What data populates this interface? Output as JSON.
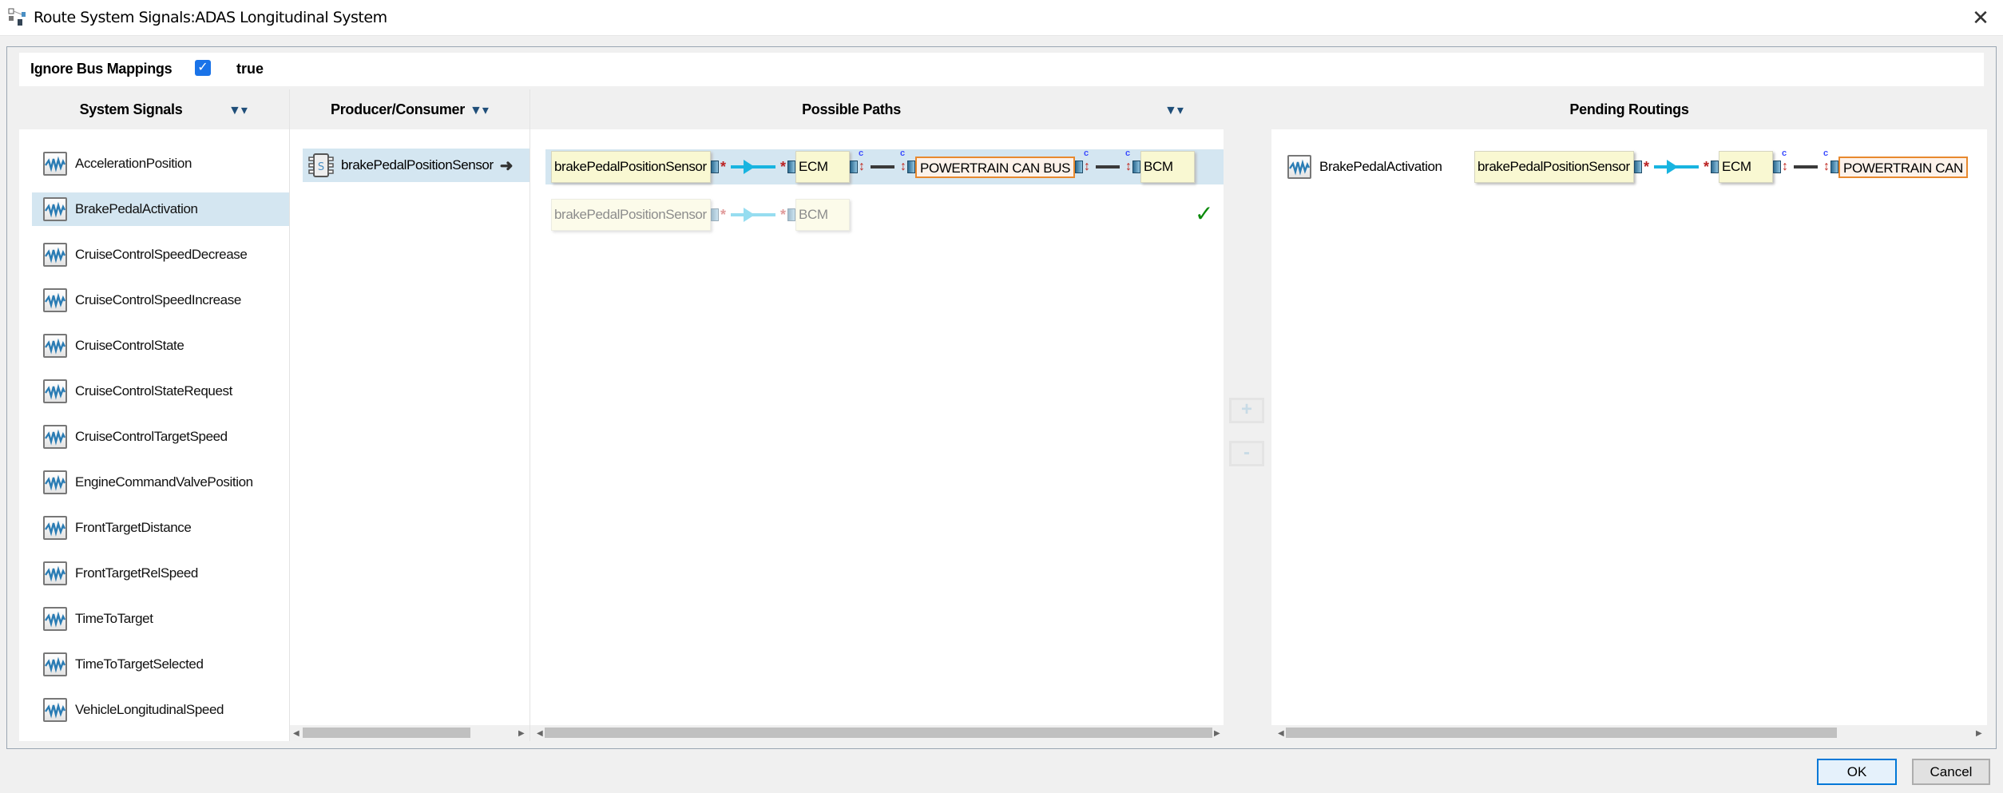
{
  "window": {
    "title": "Route System Signals:ADAS Longitudinal System",
    "close_icon": "✕"
  },
  "ignore_bus_mappings": {
    "label": "Ignore Bus Mappings",
    "checked": true,
    "value": "true"
  },
  "columns": {
    "system_signals": "System Signals",
    "producer_consumer": "Producer/Consumer",
    "possible_paths": "Possible Paths",
    "pending_routings": "Pending Routings"
  },
  "system_signals": {
    "selected": "BrakePedalActivation",
    "items": [
      "AccelerationPosition",
      "BrakePedalActivation",
      "CruiseControlSpeedDecrease",
      "CruiseControlSpeedIncrease",
      "CruiseControlState",
      "CruiseControlStateRequest",
      "CruiseControlTargetSpeed",
      "EngineCommandValvePosition",
      "FrontTargetDistance",
      "FrontTargetRelSpeed",
      "TimeToTarget",
      "TimeToTargetSelected",
      "VehicleLongitudinalSpeed"
    ]
  },
  "producer_consumer": {
    "items": [
      "brakePedalPositionSensor"
    ]
  },
  "possible_paths": [
    {
      "selected": true,
      "valid": false,
      "nodes": [
        "brakePedalPositionSensor",
        "ECM",
        "POWERTRAIN CAN BUS",
        "BCM"
      ],
      "links": [
        "signal",
        "bus",
        "bus"
      ],
      "bus_nodes": [
        2
      ]
    },
    {
      "selected": false,
      "valid": true,
      "faded": true,
      "nodes": [
        "brakePedalPositionSensor",
        "BCM"
      ],
      "links": [
        "signal"
      ],
      "bus_nodes": []
    }
  ],
  "valid_mark": "✓",
  "route_buttons": {
    "add": "+",
    "remove": "-"
  },
  "pending_routings": [
    {
      "signal": "BrakePedalActivation",
      "nodes": [
        "brakePedalPositionSensor",
        "ECM",
        "POWERTRAIN CAN"
      ],
      "links": [
        "signal",
        "bus"
      ],
      "bus_nodes": [
        2
      ]
    }
  ],
  "buttons": {
    "ok": "OK",
    "cancel": "Cancel"
  },
  "colors": {
    "selection": "#d4e6f1",
    "node": "#f9f8d2",
    "bus_border": "#e8892e",
    "signal_arrow": "#18b4e0",
    "check": "#1a73e8"
  }
}
